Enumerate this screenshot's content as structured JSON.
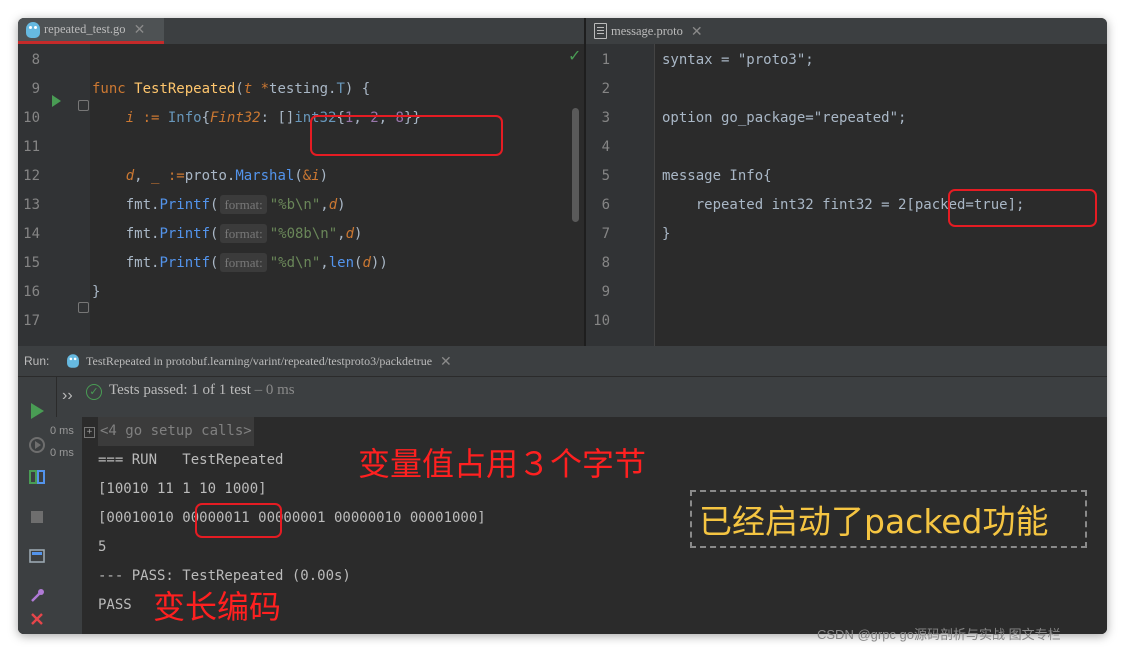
{
  "tabs": {
    "left": {
      "file": "repeated_test.go",
      "close": "✕",
      "icon": "gopher-icon"
    },
    "right": {
      "file": "message.proto",
      "close": "✕",
      "icon": "proto-file-icon"
    }
  },
  "left_editor": {
    "lines": [
      {
        "num": "8"
      },
      {
        "num": "9",
        "tokens": [
          {
            "t": "func ",
            "c": "kw"
          },
          {
            "t": "TestRepeated",
            "c": "fn"
          },
          {
            "t": "(",
            "c": "punc"
          },
          {
            "t": "t ",
            "c": "param"
          },
          {
            "t": "*",
            "c": "ptr"
          },
          {
            "t": "testing.",
            "c": "pkg"
          },
          {
            "t": "T",
            "c": "ty"
          },
          {
            "t": ") {",
            "c": "punc"
          }
        ]
      },
      {
        "num": "10",
        "tokens": [
          {
            "t": "    ",
            "c": "punc"
          },
          {
            "t": "i",
            "c": "var"
          },
          {
            "t": " := ",
            "c": "kw"
          },
          {
            "t": "Info",
            "c": "ty"
          },
          {
            "t": "{",
            "c": "punc"
          },
          {
            "t": "Fint32",
            "c": "var"
          },
          {
            "t": ": ",
            "c": "punc"
          },
          {
            "t": "[]",
            "c": "punc"
          },
          {
            "t": "int32",
            "c": "ty"
          },
          {
            "t": "{",
            "c": "punc"
          },
          {
            "t": "1",
            "c": "num"
          },
          {
            "t": ", ",
            "c": "punc"
          },
          {
            "t": "2",
            "c": "num"
          },
          {
            "t": ", ",
            "c": "punc"
          },
          {
            "t": "8",
            "c": "num"
          },
          {
            "t": "}}",
            "c": "punc"
          }
        ]
      },
      {
        "num": "11"
      },
      {
        "num": "12",
        "tokens": [
          {
            "t": "    ",
            "c": "punc"
          },
          {
            "t": "d",
            "c": "var"
          },
          {
            "t": ", ",
            "c": "punc"
          },
          {
            "t": "_",
            "c": "var"
          },
          {
            "t": " :=",
            "c": "kw"
          },
          {
            "t": "proto.",
            "c": "pkg"
          },
          {
            "t": "Marshal",
            "c": "meth"
          },
          {
            "t": "(",
            "c": "punc"
          },
          {
            "t": "&",
            "c": "ptr"
          },
          {
            "t": "i",
            "c": "var"
          },
          {
            "t": ")",
            "c": "punc"
          }
        ]
      },
      {
        "num": "13",
        "tokens": [
          {
            "t": "    ",
            "c": "punc"
          },
          {
            "t": "fmt.",
            "c": "pkg"
          },
          {
            "t": "Printf",
            "c": "meth"
          },
          {
            "t": "(",
            "c": "punc"
          },
          {
            "t": "format:",
            "c": "hint"
          },
          {
            "t": "\"%b\\n\"",
            "c": "str"
          },
          {
            "t": ",",
            "c": "punc"
          },
          {
            "t": "d",
            "c": "var"
          },
          {
            "t": ")",
            "c": "punc"
          }
        ]
      },
      {
        "num": "14",
        "tokens": [
          {
            "t": "    ",
            "c": "punc"
          },
          {
            "t": "fmt.",
            "c": "pkg"
          },
          {
            "t": "Printf",
            "c": "meth"
          },
          {
            "t": "(",
            "c": "punc"
          },
          {
            "t": "format:",
            "c": "hint"
          },
          {
            "t": "\"%08b\\n\"",
            "c": "str"
          },
          {
            "t": ",",
            "c": "punc"
          },
          {
            "t": "d",
            "c": "var"
          },
          {
            "t": ")",
            "c": "punc"
          }
        ]
      },
      {
        "num": "15",
        "tokens": [
          {
            "t": "    ",
            "c": "punc"
          },
          {
            "t": "fmt.",
            "c": "pkg"
          },
          {
            "t": "Printf",
            "c": "meth"
          },
          {
            "t": "(",
            "c": "punc"
          },
          {
            "t": "format:",
            "c": "hint"
          },
          {
            "t": "\"%d\\n\"",
            "c": "str"
          },
          {
            "t": ",",
            "c": "punc"
          },
          {
            "t": "len",
            "c": "meth"
          },
          {
            "t": "(",
            "c": "punc"
          },
          {
            "t": "d",
            "c": "var"
          },
          {
            "t": "))",
            "c": "punc"
          }
        ]
      },
      {
        "num": "16",
        "tokens": [
          {
            "t": "}",
            "c": "punc"
          }
        ]
      },
      {
        "num": "17"
      }
    ]
  },
  "right_editor": {
    "lines": [
      {
        "num": "1",
        "text": "syntax = \"proto3\";"
      },
      {
        "num": "2",
        "text": ""
      },
      {
        "num": "3",
        "text": "option go_package=\"repeated\";"
      },
      {
        "num": "4",
        "text": ""
      },
      {
        "num": "5",
        "text": "message Info{"
      },
      {
        "num": "6",
        "text": "    repeated int32 fint32 = 2[packed=true];"
      },
      {
        "num": "7",
        "text": "}"
      },
      {
        "num": "8",
        "text": ""
      },
      {
        "num": "9",
        "text": ""
      },
      {
        "num": "10",
        "text": ""
      }
    ]
  },
  "run": {
    "label": "Run:",
    "tab": "TestRepeated in protobuf.learning/varint/repeated/testproto3/packdetrue",
    "tab_close": "✕",
    "status": {
      "prefix": "Tests passed: ",
      "count": "1",
      "mid": " of 1 test",
      "time": " – 0 ms"
    },
    "tree_times": [
      "0 ms",
      "0 ms"
    ],
    "console": [
      "<4 go setup calls>",
      "=== RUN   TestRepeated",
      "[10010 11 1 10 1000]",
      "[00010010 00000011 00000001 00000010 00001000]",
      "5",
      "--- PASS: TestRepeated (0.00s)",
      "PASS"
    ]
  },
  "annotations": {
    "a1": "变量值占用３个字节",
    "a2": "变长编码",
    "a3": "已经启动了packed功能"
  },
  "watermark": "CSDN @grpc go源码剖析与实战 图文专栏",
  "colors": {
    "keyword": "#cc7832",
    "function": "#ffc66d",
    "type": "#6897bb",
    "number": "#9876aa",
    "string": "#6a8759",
    "method": "#5394ec",
    "annotation_red": "#ff2020",
    "annotation_yellow": "#f5c542",
    "pass_green": "#499c54"
  }
}
